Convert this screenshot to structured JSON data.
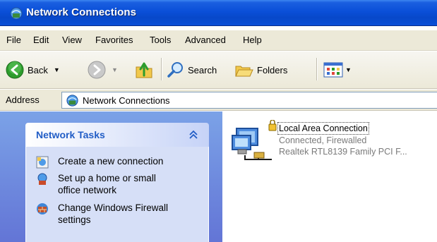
{
  "window": {
    "title": "Network Connections",
    "icon": "network-connections-icon"
  },
  "menu": [
    "File",
    "Edit",
    "View",
    "Favorites",
    "Tools",
    "Advanced",
    "Help"
  ],
  "toolbar": {
    "back_label": "Back",
    "search_label": "Search",
    "folders_label": "Folders"
  },
  "address": {
    "label": "Address",
    "value": "Network Connections"
  },
  "tasks": {
    "header": "Network Tasks",
    "items": [
      {
        "label_lines": [
          "Create a new connection"
        ],
        "icon": "new-connection-icon"
      },
      {
        "label_lines": [
          "Set up a home or small",
          "office network"
        ],
        "icon": "home-network-icon"
      },
      {
        "label_lines": [
          "Change Windows Firewall",
          "settings"
        ],
        "icon": "firewall-icon"
      }
    ]
  },
  "connection": {
    "name": "Local Area Connection",
    "status": "Connected, Firewalled",
    "device": "Realtek RTL8139 Family PCI F..."
  },
  "colors": {
    "titlebar": "#0a4fd8",
    "taskpane": "#6375d6",
    "task_header_text": "#215dc6"
  }
}
